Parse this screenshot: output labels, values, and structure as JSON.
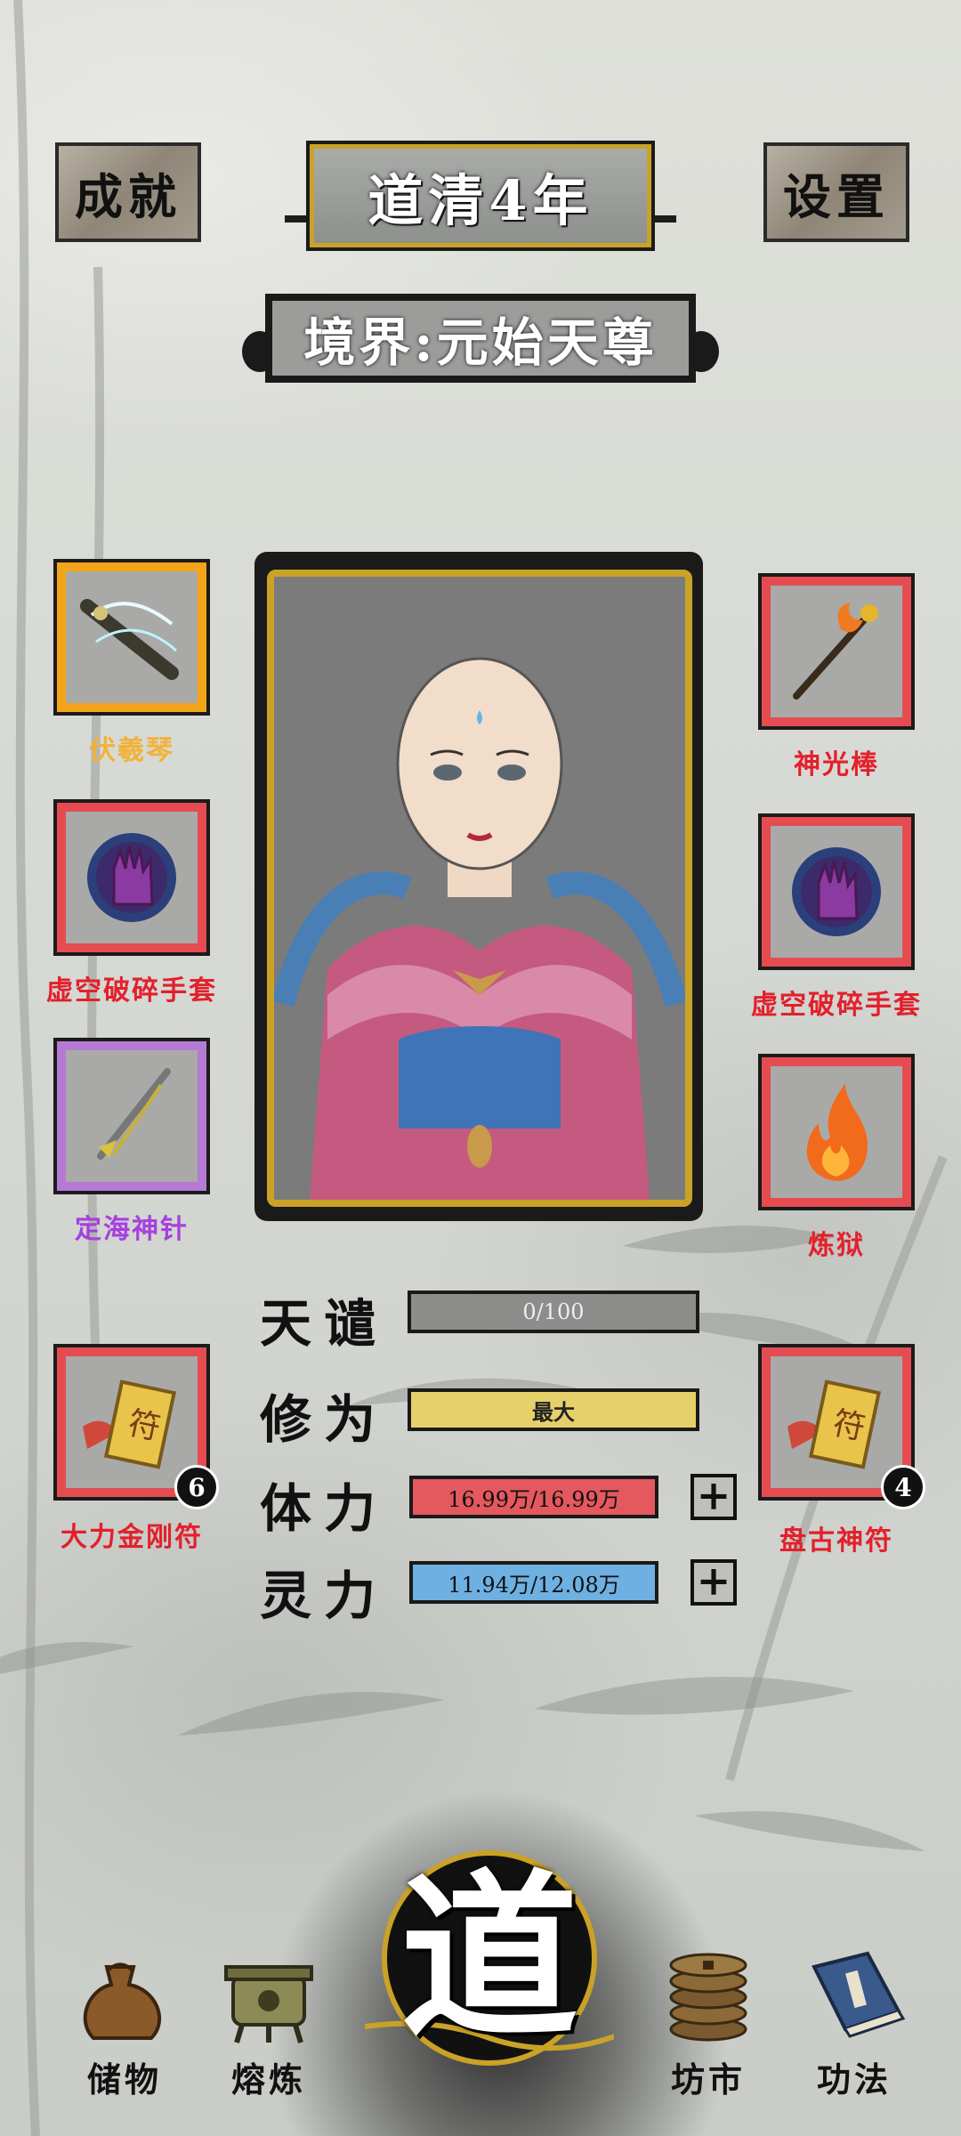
{
  "header": {
    "achievement_label": "成就",
    "year_title": "道清4年",
    "settings_label": "设置",
    "realm": "境界:元始天尊"
  },
  "equipment_left": [
    {
      "name": "伏羲琴",
      "rarity": "gold"
    },
    {
      "name": "虚空破碎手套",
      "rarity": "red"
    },
    {
      "name": "定海神针",
      "rarity": "purple"
    }
  ],
  "equipment_right": [
    {
      "name": "神光棒",
      "rarity": "red"
    },
    {
      "name": "虚空破碎手套",
      "rarity": "red"
    },
    {
      "name": "炼狱",
      "rarity": "red"
    }
  ],
  "talismans": {
    "left": {
      "name": "大力金刚符",
      "count": "6"
    },
    "right": {
      "name": "盘古神符",
      "count": "4"
    }
  },
  "stats": {
    "tribulation": {
      "label": "天谴",
      "value": "0/100",
      "fraction": 0
    },
    "cultivation": {
      "label": "修为",
      "value": "最大",
      "fraction": 1
    },
    "stamina": {
      "label": "体力",
      "value": "16.99万/16.99万",
      "fraction": 1
    },
    "spirit": {
      "label": "灵力",
      "value": "11.94万/12.08万",
      "fraction": 0.988
    }
  },
  "bottom_nav": {
    "storage": "储物",
    "smelting": "熔炼",
    "dao": "道",
    "market": "坊市",
    "skills": "功法"
  },
  "colors": {
    "gold_frame": "#f3a51a",
    "red_frame": "#e44c51",
    "purple_frame": "#b57ad3",
    "gold_text": "#f2b23a",
    "red_text": "#e3202c",
    "purple_text": "#a640e0"
  },
  "icons": {
    "achievement": "cliff-rock-icon",
    "settings": "hammer-icon",
    "storage": "sack-icon",
    "smelting": "cauldron-icon",
    "market": "coins-icon",
    "skills": "book-icon"
  }
}
